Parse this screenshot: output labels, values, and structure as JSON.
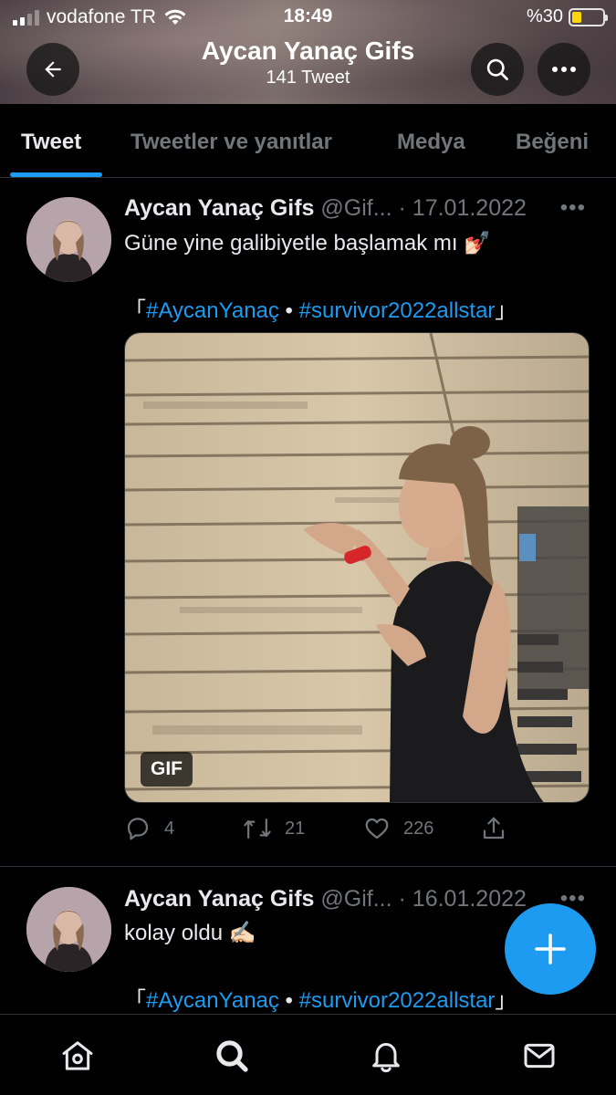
{
  "status_bar": {
    "carrier": "vodafone TR",
    "time": "18:49",
    "battery": "%30",
    "battery_level": 0.3
  },
  "header": {
    "title": "Aycan Yanaç Gifs",
    "tweet_count": "141 Tweet",
    "back_icon": "arrow-left-icon",
    "search_icon": "search-icon",
    "more_icon": "more-horizontal-icon"
  },
  "tabs": [
    {
      "label": "Tweet",
      "active": true
    },
    {
      "label": "Tweetler ve yanıtlar",
      "active": false
    },
    {
      "label": "Medya",
      "active": false
    },
    {
      "label": "Beğeni",
      "active": false
    }
  ],
  "tweets": [
    {
      "name": "Aycan Yanaç Gifs",
      "meta": "@Gif... · 17.01.2022",
      "text": "Güne yine galibiyetle başlamak mı 💅🏻",
      "tags": {
        "open": "「",
        "tag1": "#AycanYanaç",
        "sep": " • ",
        "tag2": "#survivor2022allstar",
        "close": "」"
      },
      "media_badge": "GIF",
      "replies": "4",
      "retweets": "21",
      "likes": "226"
    },
    {
      "name": "Aycan Yanaç Gifs",
      "meta": "@Gif... · 16.01.2022",
      "text": "kolay oldu ✍🏻",
      "tags": {
        "open": "「",
        "tag1": "#AycanYanaç",
        "sep": " • ",
        "tag2": "#survivor2022allstar",
        "close": "」"
      }
    }
  ],
  "more_label": "•••",
  "fab_icon": "plus-icon",
  "bottom_nav": [
    "home-icon",
    "search-icon",
    "bell-icon",
    "mail-icon"
  ],
  "colors": {
    "accent": "#1d9bf0",
    "background": "#000000",
    "secondary_text": "#71767b"
  }
}
